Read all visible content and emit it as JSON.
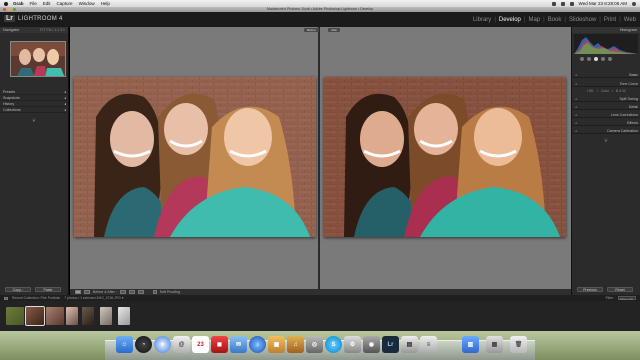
{
  "mac_menubar": {
    "app": "Grab",
    "items": [
      "File",
      "Edit",
      "Capture",
      "Window",
      "Help"
    ],
    "clock": "Wed Mar 23  8:28:06 AM"
  },
  "window": {
    "title": "Mackenzie's Pictures: Scott • Adobe Photoshop Lightroom • Develop"
  },
  "header": {
    "logo": "Lr",
    "app_name": "LIGHTROOM 4",
    "modules": [
      "Library",
      "Develop",
      "Map",
      "Book",
      "Slideshow",
      "Print",
      "Web"
    ],
    "active_module": "Develop"
  },
  "left_panel": {
    "navigator_label": "Navigator",
    "navigator_zoom": "FIT  FILL  1:1  3:1",
    "sections": [
      "Presets",
      "Snapshots",
      "History",
      "Collections"
    ],
    "copy_label": "Copy...",
    "paste_label": "Paste"
  },
  "center": {
    "before_label": "Before",
    "after_label": "After"
  },
  "toolbar": {
    "mode_label": "Before & After :",
    "softproof_label": "Soft Proofing"
  },
  "right_panel": {
    "histogram_label": "Histogram",
    "basic_label": "Basic",
    "sections": [
      "Tone Curve",
      "Split Toning",
      "Detail",
      "Lens Corrections",
      "Effects",
      "Camera Calibration"
    ],
    "hsl_row": [
      "HSL",
      "Color",
      "B & W"
    ],
    "previous_label": "Previous",
    "reset_label": "Reset"
  },
  "filmstrip": {
    "header_left": "Recent Collection: Pick Portfolio",
    "header_mid": "7 photos / 1 selected /IMG_5736.JPG ▾",
    "filter_label": "Filter :",
    "filter_value": "Filters Off"
  },
  "dock": {
    "icons": [
      "finder-icon",
      "dashboard-icon",
      "safari-icon",
      "itunes-icon",
      "ical-icon",
      "address-book-icon",
      "mail-icon",
      "iphoto-icon",
      "garageband-icon",
      "photoshop-icon",
      "skype-icon",
      "lightroom-icon",
      "system-prefs-icon",
      "trash-icon"
    ]
  },
  "colors": {
    "accent": "#f0f0f0",
    "panel_bg": "#2b2b2b",
    "center_bg": "#7a7a7a"
  }
}
